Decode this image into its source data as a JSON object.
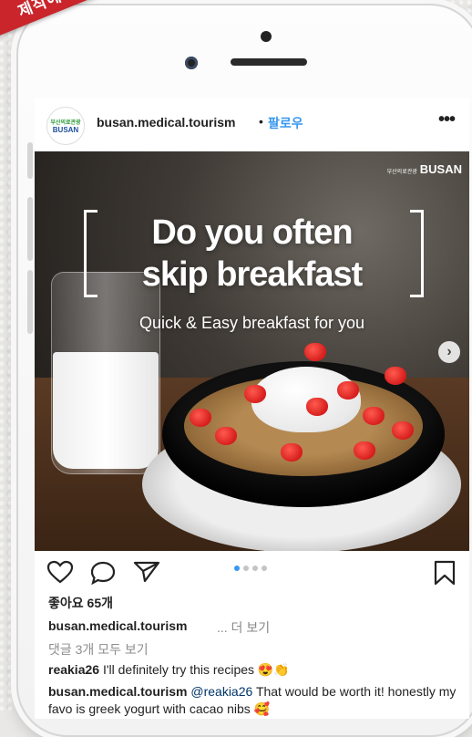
{
  "ribbon": {
    "label": "제작예시"
  },
  "profile": {
    "avatar_line1": "부산의료관광",
    "avatar_line2": "BUSAN",
    "username": "busan.medical.tourism",
    "separator": "•",
    "follow": "팔로우",
    "more": "•••"
  },
  "post": {
    "brand_small": "부산의료관광",
    "brand_large": "BUSAN",
    "headline_1": "Do you often",
    "headline_2": "skip breakfast",
    "subtitle": "Quick & Easy breakfast for you",
    "carousel_index": 1,
    "carousel_total": 4
  },
  "actions": {
    "likes": "좋아요 65개"
  },
  "caption": {
    "username": "busan.medical.tourism",
    "more": "... 더 보기",
    "view_all": "댓글 3개 모두 보기"
  },
  "comments": [
    {
      "user": "reakia26",
      "text": "I'll definitely try this recipes 😍👏"
    },
    {
      "user": "busan.medical.tourism",
      "mention": "@reakia26",
      "text": "That would be worth it! honestly my favo is greek yogurt with cacao nibs 🥰"
    }
  ],
  "colors": {
    "accent_blue": "#3897f0",
    "ribbon_red": "#c9252b"
  }
}
